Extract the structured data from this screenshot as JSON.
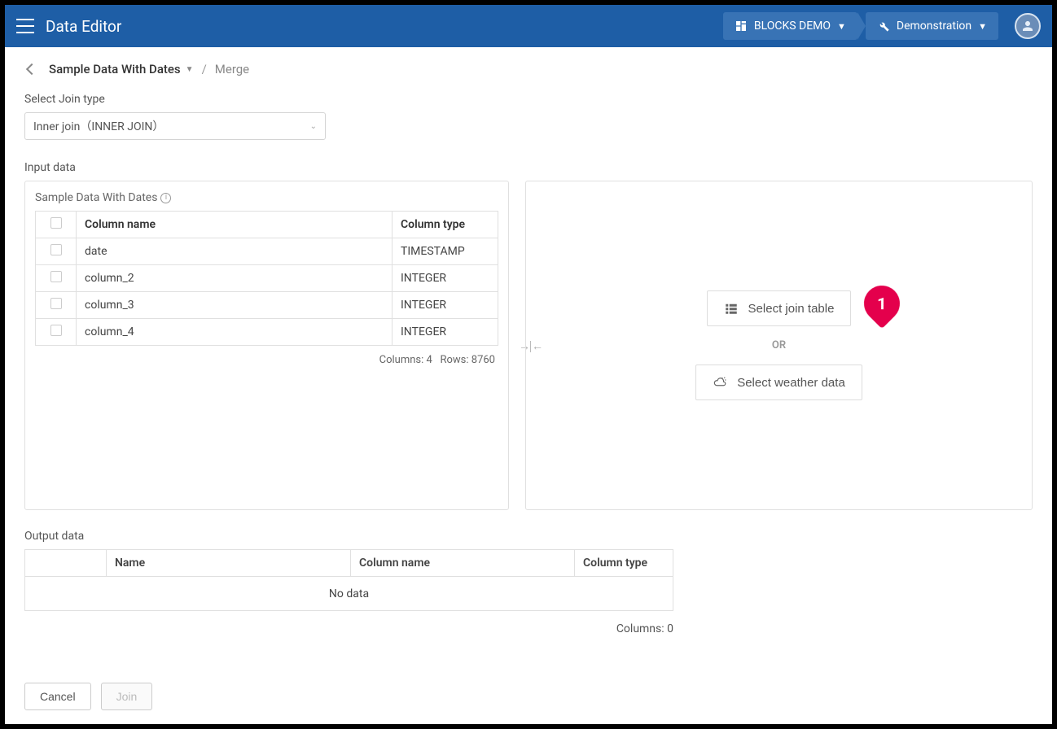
{
  "header": {
    "title": "Data Editor",
    "project_chip": "BLOCKS DEMO",
    "tool_chip": "Demonstration"
  },
  "breadcrumb": {
    "main": "Sample Data With Dates",
    "sub": "Merge"
  },
  "join_type": {
    "label": "Select Join type",
    "value": "Inner join（INNER JOIN）"
  },
  "input_data": {
    "section_label": "Input data",
    "panel_title": "Sample Data With Dates",
    "headers": {
      "name": "Column name",
      "type": "Column type"
    },
    "rows": [
      {
        "name": "date",
        "type": "TIMESTAMP"
      },
      {
        "name": "column_2",
        "type": "INTEGER"
      },
      {
        "name": "column_3",
        "type": "INTEGER"
      },
      {
        "name": "column_4",
        "type": "INTEGER"
      }
    ],
    "footer_cols": "Columns: 4",
    "footer_rows": "Rows: 8760"
  },
  "right_panel": {
    "select_join_table": "Select join table",
    "or": "OR",
    "select_weather": "Select weather data"
  },
  "output": {
    "section_label": "Output data",
    "headers": {
      "name": "Name",
      "colname": "Column name",
      "coltype": "Column type"
    },
    "no_data": "No data",
    "footer": "Columns: 0"
  },
  "buttons": {
    "cancel": "Cancel",
    "join": "Join"
  },
  "annotation": {
    "num": "1"
  }
}
